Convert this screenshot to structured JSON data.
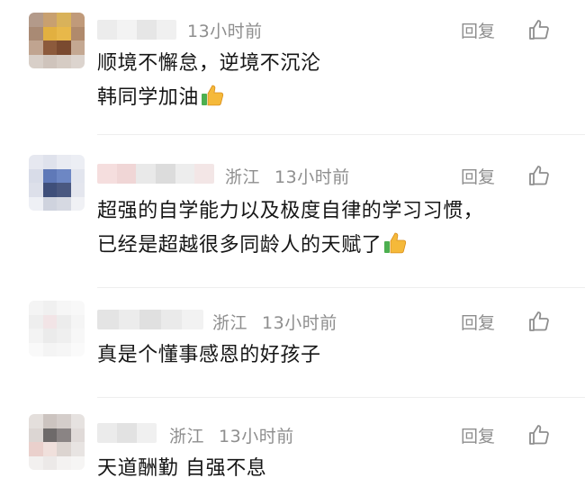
{
  "comments": [
    {
      "location": "",
      "time": "13小时前",
      "lines": [
        "顺境不懈怠，逆境不沉沦",
        "韩同学加油"
      ],
      "emoji": "thumbs-up",
      "reply_label": "回复"
    },
    {
      "location": "浙江",
      "time": "13小时前",
      "lines": [
        "超强的自学能力以及极度自律的学习习惯，",
        "已经是超越很多同龄人的天赋了"
      ],
      "emoji": "thumbs-up",
      "reply_label": "回复"
    },
    {
      "location": "浙江",
      "time": "13小时前",
      "lines": [
        "真是个懂事感恩的好孩子"
      ],
      "emoji": "",
      "reply_label": "回复"
    },
    {
      "location": "浙江",
      "time": "13小时前",
      "lines": [
        "天道酬勤 自强不息"
      ],
      "emoji": "",
      "reply_label": "回复"
    }
  ],
  "colors": {
    "meta_text": "#8e8e8e",
    "body_text": "#161616",
    "emoji_yellow": "#f5b93a",
    "emoji_green": "#4caf50"
  },
  "icons": {
    "like": "thumbs-up-outline-icon",
    "emoji": "thumbs-up-emoji-icon"
  }
}
